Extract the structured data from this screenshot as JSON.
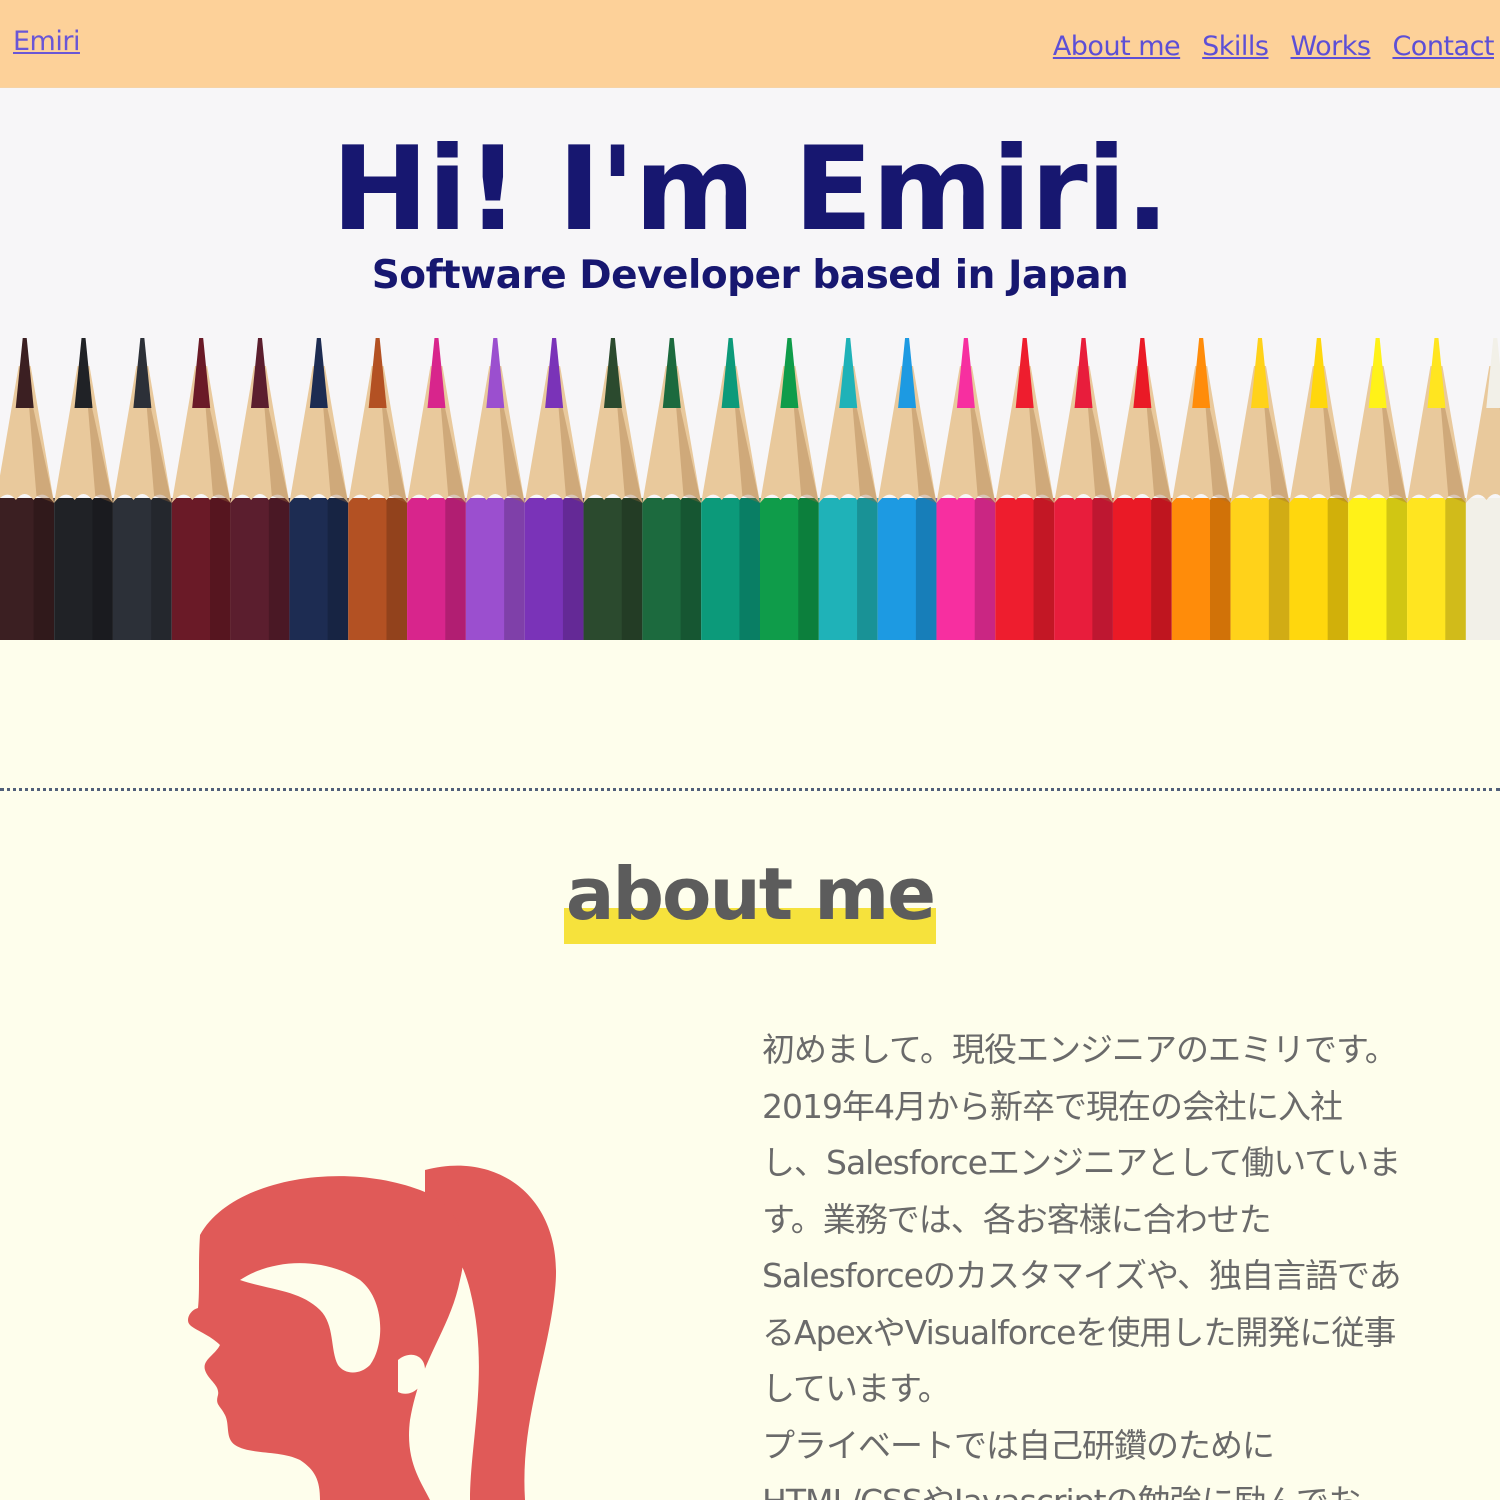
{
  "header": {
    "brand": "Emiri",
    "nav": [
      "About me",
      "Skills",
      "Works",
      "Contact"
    ]
  },
  "hero": {
    "title": "Hi! I'm Emiri.",
    "subtitle": "Software Developer based in Japan",
    "pencil_colors": [
      "#3b1f22",
      "#202226",
      "#2c3038",
      "#6a1a27",
      "#5b1e2e",
      "#1d2c52",
      "#b35123",
      "#d8258c",
      "#9b4fcf",
      "#7a33b8",
      "#2b4a2e",
      "#1c6a3e",
      "#0c9a7a",
      "#0f9c4a",
      "#1fb2b8",
      "#1d9ae2",
      "#f72fa0",
      "#ee1d2e",
      "#e81d3c",
      "#ea1a26",
      "#ff8c0a",
      "#ffd21a",
      "#ffd70d",
      "#fff218",
      "#ffe520",
      "#f2f0e8"
    ]
  },
  "about": {
    "heading": "about me",
    "bio": [
      "初めまして。現役エンジニアのエミリです。",
      "2019年4月から新卒で現在の会社に入社",
      "し、Salesforceエンジニアとして働いていま",
      "す。業務では、各お客様に合わせた",
      "Salesforceのカスタマイズや、独自言語であ",
      "るApexやVisualforceを使用した開発に従事",
      "しています。",
      "プライベートでは自己研鑽のために",
      "HTML/CSSやJavascriptの勉強に励んでお"
    ],
    "avatar_color": "#e05a58"
  },
  "colors": {
    "header_bg": "#fdd199",
    "link": "#5d4fd6",
    "title": "#171770",
    "highlight": "#f6e23c",
    "page_bg": "#fefeec"
  }
}
